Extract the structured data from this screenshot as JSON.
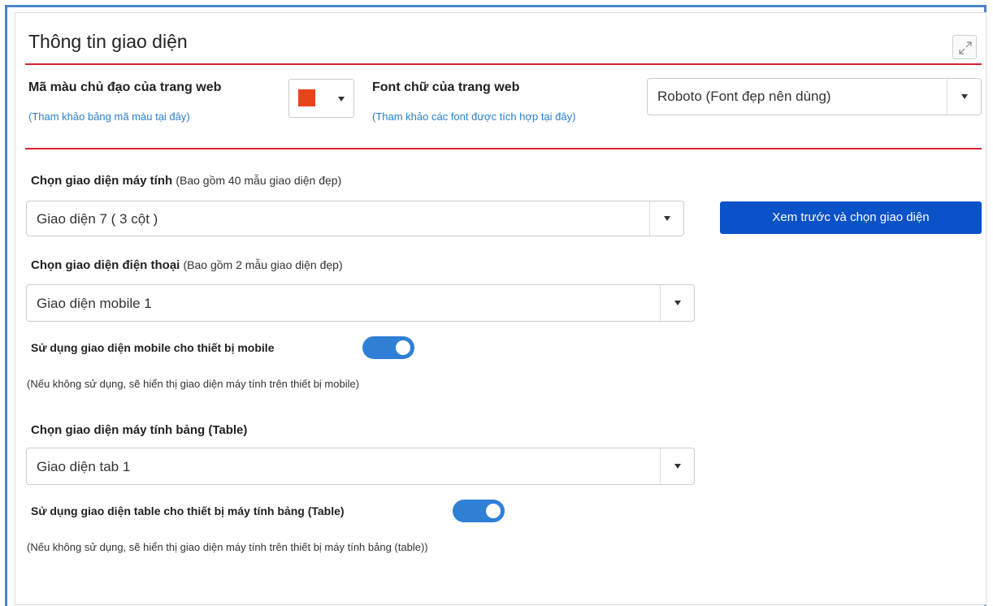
{
  "panel": {
    "title": "Thông tin giao diện"
  },
  "theme_color": {
    "label": "Mã màu chủ đạo của trang web",
    "link": "(Tham khảo bảng mã màu tại đây)",
    "value": "#e8441c"
  },
  "font": {
    "label": "Font chữ của trang web",
    "link": "(Tham khảo các font được tích hợp tại đây)",
    "selected": "Roboto (Font đẹp nên dùng)"
  },
  "desktop": {
    "label": "Chọn giao diện máy tính",
    "hint": "(Bao gồm 40 mẫu giao diện đẹp)",
    "selected": "Giao diện 7 ( 3 cột )",
    "preview_button": "Xem trước và chọn giao diện"
  },
  "mobile": {
    "label": "Chọn giao diện điện thoại",
    "hint": "(Bao gồm 2 mẫu giao diện đẹp)",
    "selected": "Giao diện mobile 1",
    "toggle_label": "Sử dụng giao diện mobile cho thiết bị mobile",
    "toggle_on": true,
    "note": "(Nếu không sử dụng, sẽ hiển thị giao diện máy tính trên thiết bị mobile)"
  },
  "tablet": {
    "label": "Chọn giao diện máy tính bảng (Table)",
    "selected": "Giao diện tab 1",
    "toggle_label": "Sử dụng giao diện table cho thiết bị máy tính bảng (Table)",
    "toggle_on": true,
    "note": "(Nếu không sử dụng, sẽ hiển thị giao diện máy tính trên thiết bị máy tính bảng (table))"
  },
  "colors": {
    "accent_line": "#d9232d",
    "primary_button": "#0a52c7",
    "toggle_on": "#2f7fd6",
    "link": "#2a7fc9"
  }
}
